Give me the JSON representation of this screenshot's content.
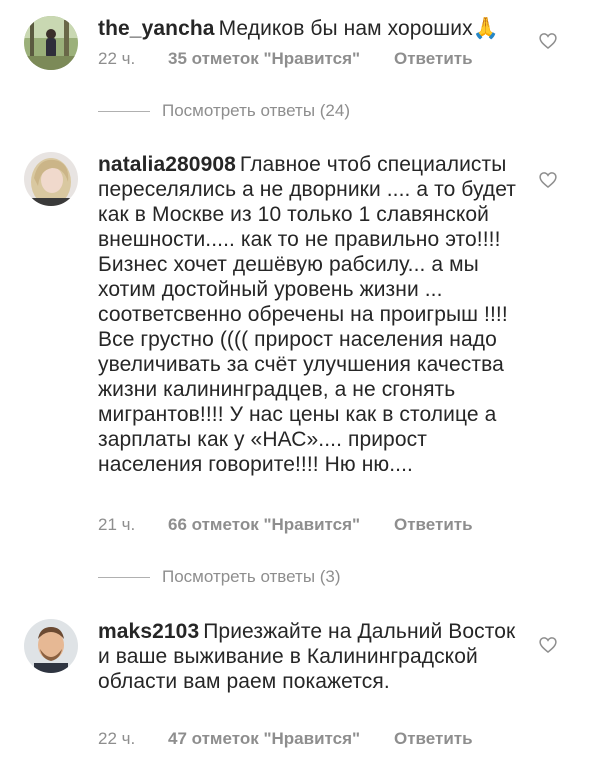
{
  "comments": [
    {
      "username": "the_yancha",
      "text": "Медиков бы нам хороших🙏",
      "time": "22 ч.",
      "likes": "35 отметок \"Нравится\"",
      "reply_label": "Ответить",
      "view_replies": "Посмотреть ответы (24)"
    },
    {
      "username": "natalia280908",
      "text": "Главное чтоб специалисты переселялись а не дворники .... а то будет как в Москве из 10 только 1 славянской внешности..... как то не правильно это!!!! Бизнес хочет дешёвую рабсилу... а мы хотим достойный уровень жизни ... соответсвенно обречены на проигрыш !!!! Все грустно (((( прирост населения надо увеличивать за счёт улучшения качества жизни калининградцев, а не сгонять мигрантов!!!! У нас цены как в столице а зарплаты как у «НАС».... прирост населения говорите!!!! Ню ню....",
      "time": "21 ч.",
      "likes": "66 отметок \"Нравится\"",
      "reply_label": "Ответить",
      "view_replies": "Посмотреть ответы (3)"
    },
    {
      "username": "maks2103",
      "text": "Приезжайте на Дальний Восток и ваше выживание в Калининградской области вам раем покажется.",
      "time": "22 ч.",
      "likes": "47 отметок \"Нравится\"",
      "reply_label": "Ответить"
    }
  ],
  "icons": {
    "like": "heart-outline-icon"
  }
}
